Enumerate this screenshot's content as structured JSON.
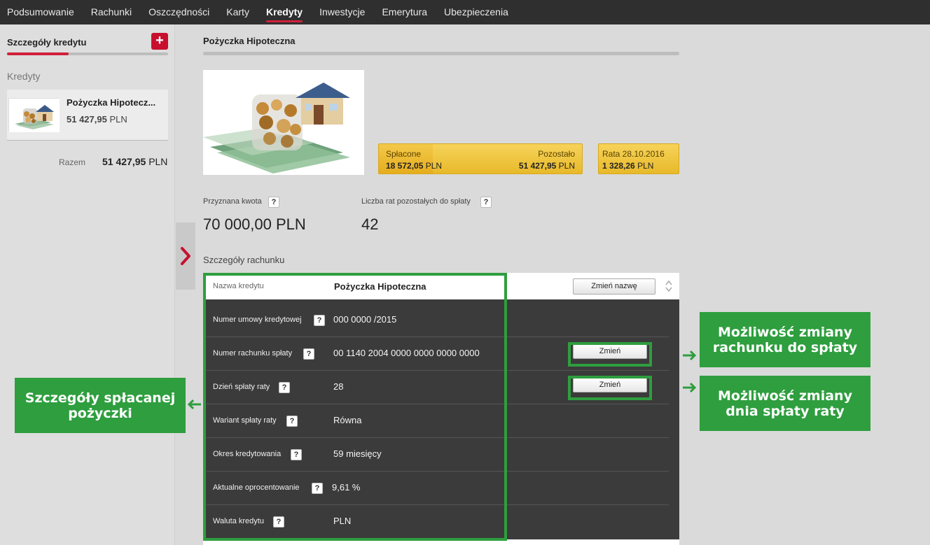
{
  "nav": {
    "items": [
      {
        "label": "Podsumowanie"
      },
      {
        "label": "Rachunki"
      },
      {
        "label": "Oszczędności"
      },
      {
        "label": "Karty"
      },
      {
        "label": "Kredyty"
      },
      {
        "label": "Inwestycje"
      },
      {
        "label": "Emerytura"
      },
      {
        "label": "Ubezpieczenia"
      }
    ],
    "active": "Kredyty",
    "accent": "#d0203a"
  },
  "sidebar": {
    "title": "Szczegóły kredytu",
    "add_label": "+",
    "section": "Kredyty",
    "loan": {
      "name": "Pożyczka Hipotecz...",
      "amount": "51 427,95",
      "currency": "PLN"
    },
    "total_label": "Razem",
    "total_amount": "51 427,95",
    "total_currency": "PLN"
  },
  "main": {
    "title": "Pożyczka Hipoteczna",
    "repayment": {
      "paid_label": "Spłacone",
      "paid_amount": "18 572,05",
      "paid_currency": "PLN",
      "remaining_label": "Pozostało",
      "remaining_amount": "51 427,95",
      "remaining_currency": "PLN",
      "paid_fraction": 0.265
    },
    "installment": {
      "label": "Rata 28.10.2016",
      "amount": "1 328,26",
      "currency": "PLN"
    },
    "granted_label": "Przyznana kwota",
    "granted_value": "70 000,00 PLN",
    "remaining_count_label": "Liczba rat pozostałych do spłaty",
    "remaining_count_value": "42",
    "help_glyph": "?",
    "details_label": "Szczegóły rachunku",
    "details": {
      "name_label": "Nazwa kredytu",
      "name_value": "Pożyczka Hipoteczna",
      "rename_button": "Zmień nazwę",
      "change_button": "Zmień",
      "rows": [
        {
          "label": "Numer umowy kredytowej",
          "value": "000 0000 /2015"
        },
        {
          "label": "Numer rachunku spłaty",
          "value": "00 1140 2004 0000 0000 0000 0000"
        },
        {
          "label": "Dzień spłaty raty",
          "value": "28"
        },
        {
          "label": "Wariant spłaty raty",
          "value": "Równa"
        },
        {
          "label": "Okres kredytowania",
          "value": "59 miesięcy"
        },
        {
          "label": "Aktualne oprocentowanie",
          "value": "9,61 %"
        },
        {
          "label": "Waluta kredytu",
          "value": "PLN"
        }
      ]
    }
  },
  "annotations": {
    "color": "#2e9e3e",
    "left": "Szczegóły spłacanej pożyczki",
    "right_top": "Możliwość zmiany rachunku do spłaty",
    "right_bottom": "Możliwość zmiany dnia spłaty raty"
  }
}
